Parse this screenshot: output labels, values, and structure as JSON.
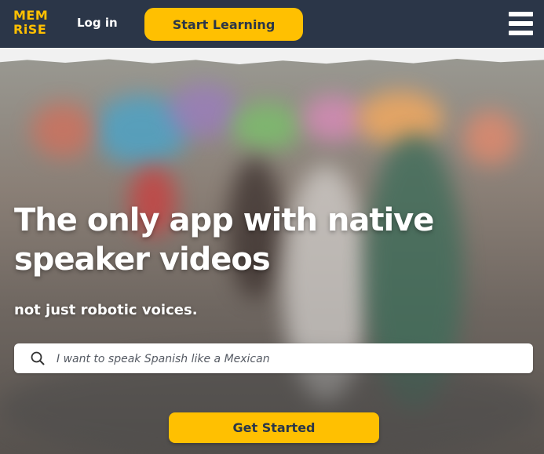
{
  "header": {
    "logo_line1": "MEM",
    "logo_line2": "RiSE",
    "login_label": "Log in",
    "start_learning_label": "Start Learning"
  },
  "hero": {
    "headline": "The only app with native speaker videos",
    "subheadline": "not just robotic voices.",
    "search_placeholder": "I want to speak Spanish like a Mexican",
    "get_started_label": "Get Started"
  },
  "colors": {
    "brand_yellow": "#ffc001",
    "navy": "#2b3648",
    "white": "#ffffff"
  },
  "icons": {
    "menu": "hamburger-menu-icon",
    "search": "search-icon"
  }
}
